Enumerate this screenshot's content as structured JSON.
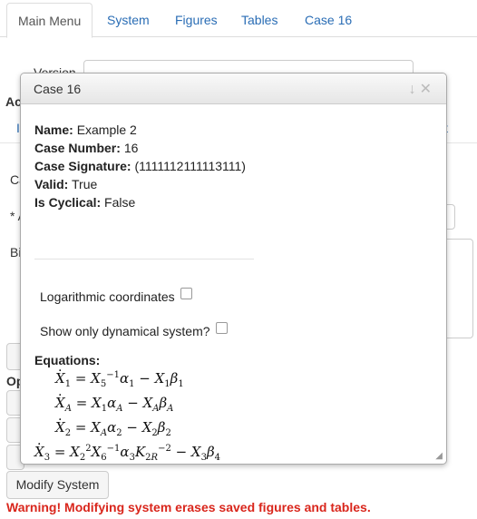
{
  "tabs": [
    "Main Menu",
    "System",
    "Figures",
    "Tables",
    "Case 16"
  ],
  "background": {
    "version_label": "Version",
    "partial_ac": "Ac",
    "partial_c": "Ca",
    "partial_star": "* A",
    "partial_bi": "Bi",
    "partial_op": "Op",
    "partial_t": "t",
    "modify_button": "Modify System",
    "warning": "Warning! Modifying system erases saved figures and tables."
  },
  "dialog": {
    "title": "Case 16",
    "name_label": "Name:",
    "name_value": "Example 2",
    "case_number_label": "Case Number:",
    "case_number_value": "16",
    "signature_label": "Case Signature:",
    "signature_value": "(1111112111113111)",
    "valid_label": "Valid:",
    "valid_value": "True",
    "cyclical_label": "Is Cyclical:",
    "cyclical_value": "False",
    "log_coords_label": "Logarithmic coordinates",
    "show_dyn_label": "Show only dynamical system?",
    "equations_label": "Equations:"
  },
  "colors": {
    "link": "#2a6db5",
    "warning": "#d9261c"
  }
}
